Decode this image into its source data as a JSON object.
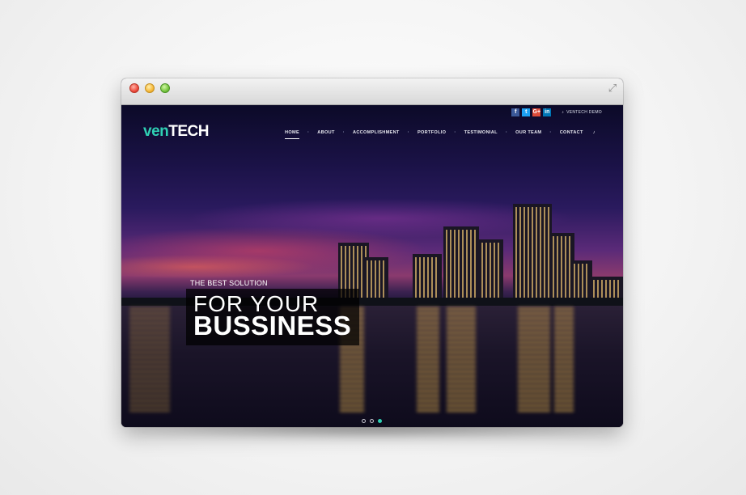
{
  "browser": {
    "controls": [
      "close",
      "minimize",
      "zoom"
    ],
    "expand_icon": "expand-icon"
  },
  "site": {
    "logo": {
      "part1": "ven",
      "part2": "TECH"
    },
    "social": [
      {
        "name": "facebook",
        "glyph": "f",
        "color": "#3b5998"
      },
      {
        "name": "twitter",
        "glyph": "t",
        "color": "#1da1f2"
      },
      {
        "name": "google-plus",
        "glyph": "G+",
        "color": "#dd4b39"
      },
      {
        "name": "linkedin",
        "glyph": "in",
        "color": "#0077b5"
      }
    ],
    "demo_label": "VENTECH DEMO",
    "nav": [
      "HOME",
      "ABOUT",
      "ACCOMPLISHMENT",
      "PORTFOLIO",
      "TESTIMONIAL",
      "OUR TEAM",
      "CONTACT"
    ],
    "nav_active": "HOME",
    "hero": {
      "kicker": "THE BEST SOLUTION",
      "line1": "FOR YOUR",
      "line2": "BUSSINESS"
    },
    "slider": {
      "count": 3,
      "active_index": 3
    },
    "colors": {
      "accent": "#2fd0b4",
      "sky_top": "#0c0a28",
      "sunset": "#8a3a6e"
    }
  }
}
